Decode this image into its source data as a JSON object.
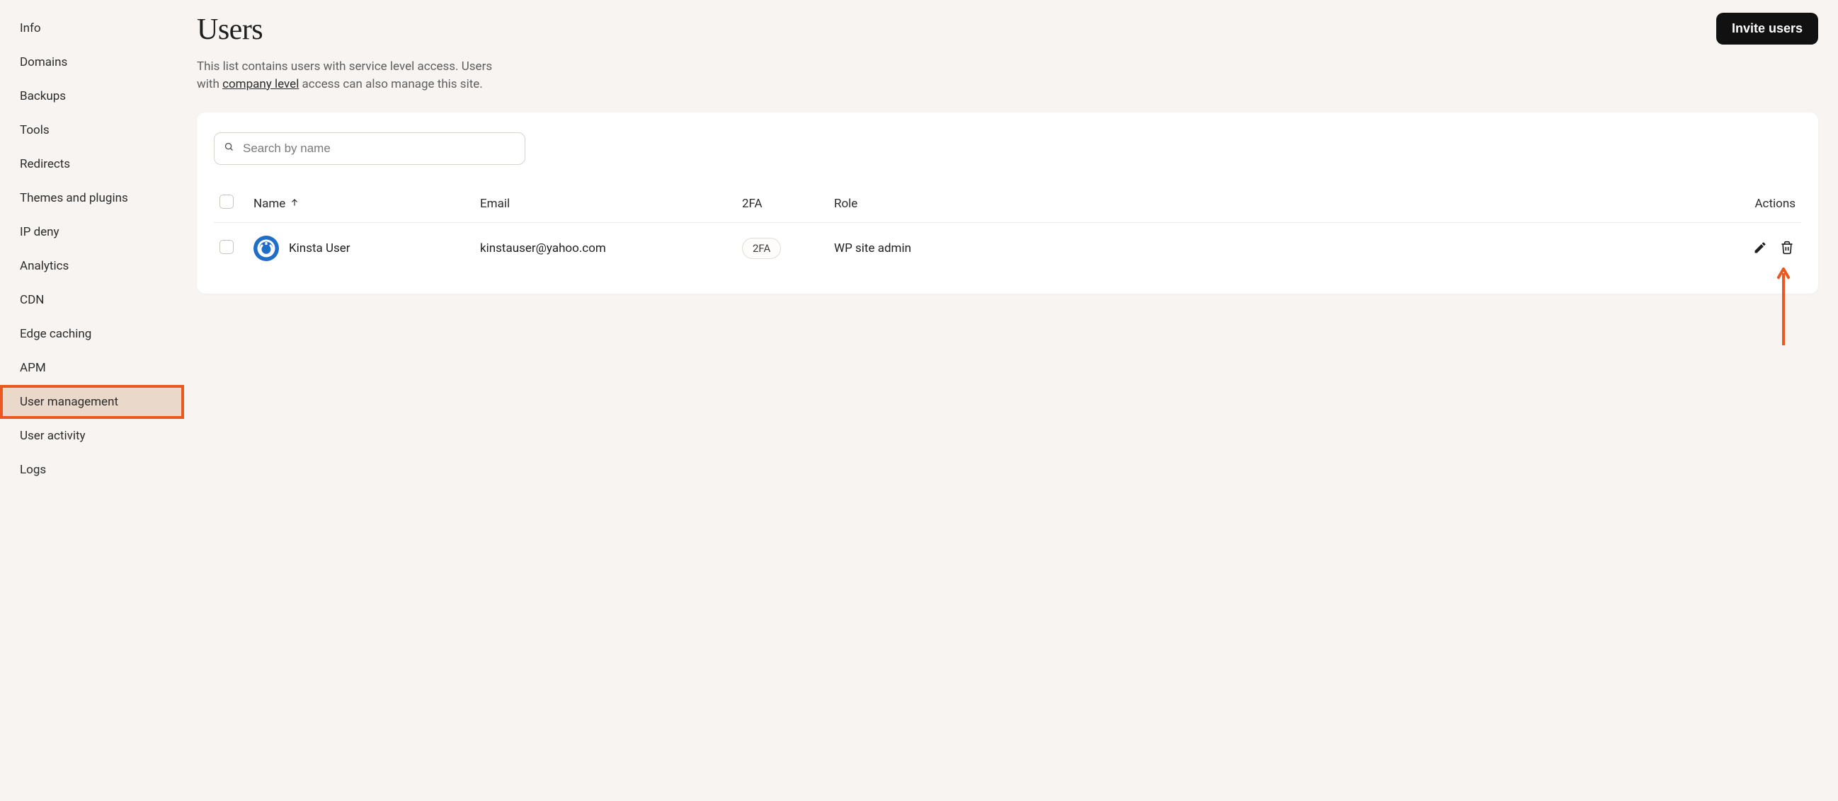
{
  "sidebar": {
    "items": [
      {
        "label": "Info",
        "active": false
      },
      {
        "label": "Domains",
        "active": false
      },
      {
        "label": "Backups",
        "active": false
      },
      {
        "label": "Tools",
        "active": false
      },
      {
        "label": "Redirects",
        "active": false
      },
      {
        "label": "Themes and plugins",
        "active": false
      },
      {
        "label": "IP deny",
        "active": false
      },
      {
        "label": "Analytics",
        "active": false
      },
      {
        "label": "CDN",
        "active": false
      },
      {
        "label": "Edge caching",
        "active": false
      },
      {
        "label": "APM",
        "active": false
      },
      {
        "label": "User management",
        "active": true
      },
      {
        "label": "User activity",
        "active": false
      },
      {
        "label": "Logs",
        "active": false
      }
    ]
  },
  "header": {
    "title": "Users",
    "subtitle_before": "This list contains users with service level access. Users with ",
    "subtitle_link": "company level",
    "subtitle_after": " access can also manage this site.",
    "invite_button": "Invite users"
  },
  "search": {
    "placeholder": "Search by name"
  },
  "table": {
    "columns": {
      "name": "Name",
      "email": "Email",
      "twofa": "2FA",
      "role": "Role",
      "actions": "Actions"
    },
    "rows": [
      {
        "name": "Kinsta User",
        "email": "kinstauser@yahoo.com",
        "twofa_badge": "2FA",
        "role": "WP site admin"
      }
    ]
  }
}
